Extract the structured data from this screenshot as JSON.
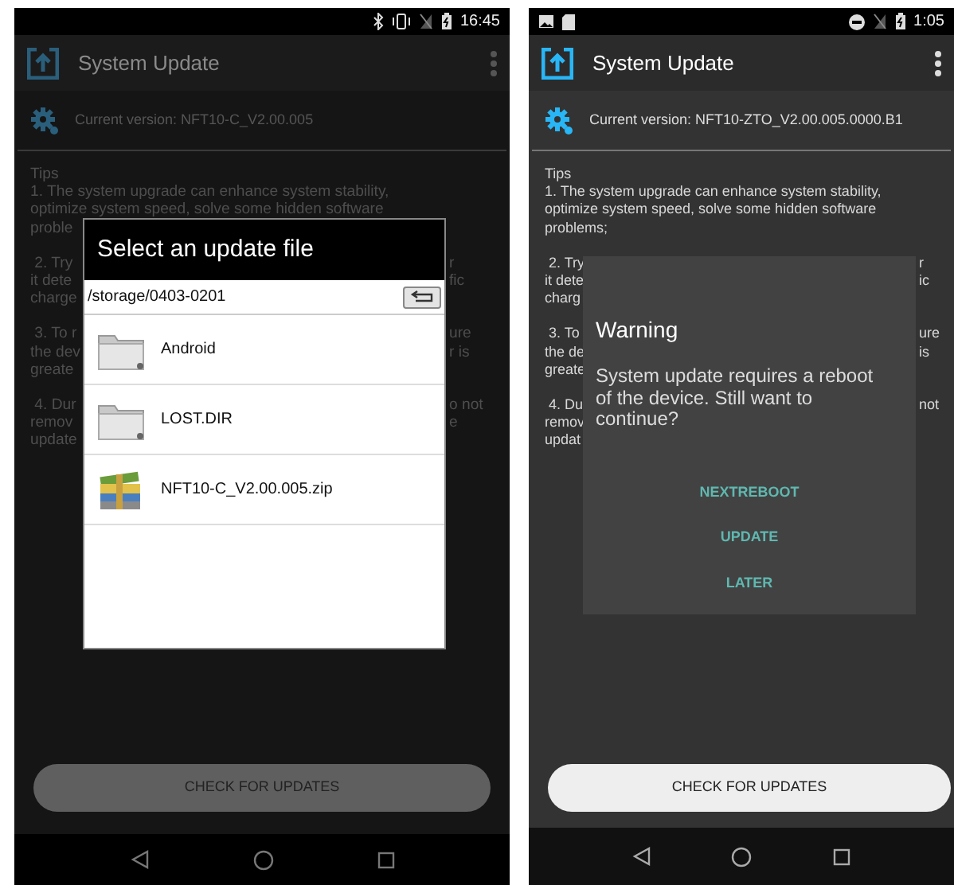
{
  "screens": [
    {
      "status_bar": {
        "right_icons": [
          {
            "kind": "bluetooth"
          },
          {
            "kind": "vibrate"
          },
          {
            "kind": "no_sim"
          },
          {
            "kind": "battery"
          }
        ],
        "time": "16:45"
      },
      "app_bar": {
        "title": "System Update"
      },
      "version": "Current version: NFT10-C_V2.00.005",
      "tips_heading": "Tips",
      "tips": [
        {
          "lines": [
            {
              "left": "1. The system upgrade can enhance system stability,"
            },
            {
              "left": "optimize system speed, solve some hidden software"
            },
            {
              "left": "proble"
            }
          ]
        },
        {
          "lines": [
            {
              "left": " 2. Try",
              "right": "r"
            },
            {
              "left": "it dete",
              "right": "fic"
            },
            {
              "left": "charge"
            }
          ]
        },
        {
          "lines": [
            {
              "left": " 3. To r",
              "right": "ure"
            },
            {
              "left": "the dev",
              "right": "r is"
            },
            {
              "left": "greate"
            }
          ]
        },
        {
          "lines": [
            {
              "left": " 4. Dur",
              "right": "o not"
            },
            {
              "left": "remov",
              "right": "e"
            },
            {
              "left": "update"
            }
          ]
        }
      ],
      "dialog": {
        "kind": "file_picker",
        "title": "Select an update file",
        "path": "/storage/0403-0201",
        "files": [
          {
            "name": "Android",
            "kind": "folder"
          },
          {
            "name": "LOST.DIR",
            "kind": "folder"
          },
          {
            "name": "NFT10-C_V2.00.005.zip",
            "kind": "archive"
          }
        ]
      },
      "check_button": "CHECK FOR UPDATES"
    },
    {
      "status_bar": {
        "left_icons": [
          {
            "kind": "image"
          },
          {
            "kind": "sd_card"
          }
        ],
        "right_icons": [
          {
            "kind": "do_not_disturb"
          },
          {
            "kind": "no_sim"
          },
          {
            "kind": "battery"
          }
        ],
        "time": "1:05"
      },
      "app_bar": {
        "title": "System Update"
      },
      "version": "Current version: NFT10-ZTO_V2.00.005.0000.B1",
      "tips_heading": "Tips",
      "tips": [
        {
          "lines": [
            {
              "left": "1. The system upgrade can enhance system stability,"
            },
            {
              "left": "optimize system speed, solve some hidden software"
            },
            {
              "left": "problems;"
            }
          ]
        },
        {
          "lines": [
            {
              "left": " 2. Try",
              "right": "r"
            },
            {
              "left": "it dete",
              "right": "ic"
            },
            {
              "left": "charg"
            }
          ]
        },
        {
          "lines": [
            {
              "left": " 3. To",
              "right": "ure"
            },
            {
              "left": "the de",
              "right": "is"
            },
            {
              "left": "greate"
            }
          ]
        },
        {
          "lines": [
            {
              "left": " 4. Du",
              "right": "not"
            },
            {
              "left": "remov"
            },
            {
              "left": "updat"
            }
          ]
        }
      ],
      "dialog": {
        "kind": "alert",
        "title": "Warning",
        "message": "System update requires a reboot of the device. Still want to continue?",
        "actions": [
          "NEXTREBOOT",
          "UPDATE",
          "LATER"
        ]
      },
      "check_button": "CHECK FOR UPDATES"
    }
  ]
}
